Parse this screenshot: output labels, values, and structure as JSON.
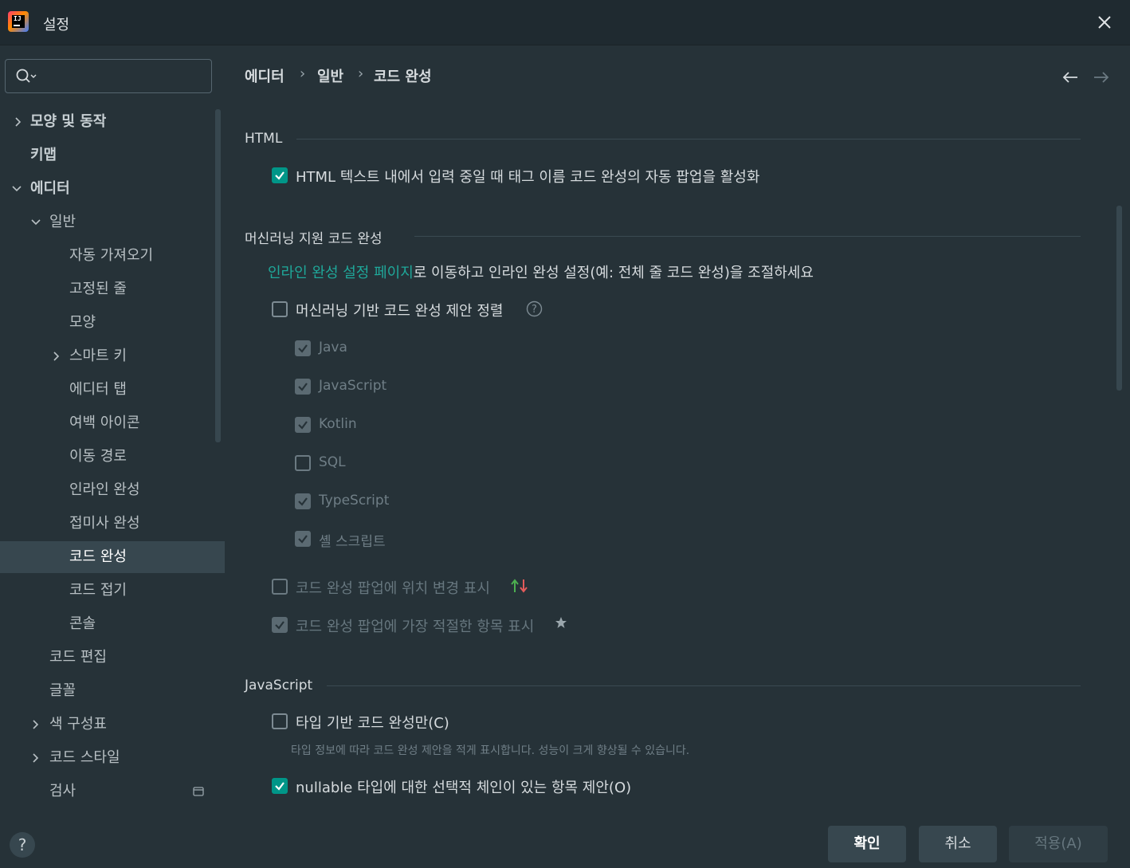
{
  "window": {
    "title": "설정"
  },
  "search": {
    "placeholder": ""
  },
  "sidebar": {
    "items": [
      {
        "label": "모양 및 동작"
      },
      {
        "label": "키맵"
      },
      {
        "label": "에디터"
      },
      {
        "label": "일반"
      },
      {
        "label": "자동 가져오기"
      },
      {
        "label": "고정된 줄"
      },
      {
        "label": "모양"
      },
      {
        "label": "스마트 키"
      },
      {
        "label": "에디터 탭"
      },
      {
        "label": "여백 아이콘"
      },
      {
        "label": "이동 경로"
      },
      {
        "label": "인라인 완성"
      },
      {
        "label": "접미사 완성"
      },
      {
        "label": "코드 완성"
      },
      {
        "label": "코드 접기"
      },
      {
        "label": "콘솔"
      },
      {
        "label": "코드 편집"
      },
      {
        "label": "글꼴"
      },
      {
        "label": "색 구성표"
      },
      {
        "label": "코드 스타일"
      },
      {
        "label": "검사"
      }
    ]
  },
  "breadcrumb": {
    "items": [
      "에디터",
      "일반",
      "코드 완성"
    ],
    "separator": "›"
  },
  "sections": {
    "html": {
      "title": "HTML",
      "option": "HTML 텍스트 내에서 입력 중일 때 태그 이름 코드 완성의 자동 팝업을 활성화"
    },
    "ml": {
      "title": "머신러닝 지원 코드 완성",
      "link_text": "인라인 완성 설정 페이지",
      "link_suffix": "로 이동하고 인라인 완성 설정(예: 전체 줄 코드 완성)을 조절하세요",
      "sort_option": "머신러닝 기반 코드 완성 제안 정렬",
      "languages": [
        "Java",
        "JavaScript",
        "Kotlin",
        "SQL",
        "TypeScript",
        "셸 스크립트"
      ],
      "position_option": "코드 완성 팝업에 위치 변경 표시",
      "best_option": "코드 완성 팝업에 가장 적절한 항목 표시"
    },
    "js": {
      "title": "JavaScript",
      "type_option": "타입 기반 코드 완성만(C)",
      "type_hint": "타입 정보에 따라 코드 완성 제안을 적게 표시합니다. 성능이 크게 향상될 수 있습니다.",
      "nullable_option": "nullable 타입에 대한 선택적 체인이 있는 항목 제안(O)"
    }
  },
  "buttons": {
    "ok": "확인",
    "cancel": "취소",
    "apply": "적용(A)",
    "help": "?"
  },
  "colors": {
    "accent": "#009688",
    "link": "#1fa89a",
    "background": "#263238",
    "selected": "#37474f"
  }
}
